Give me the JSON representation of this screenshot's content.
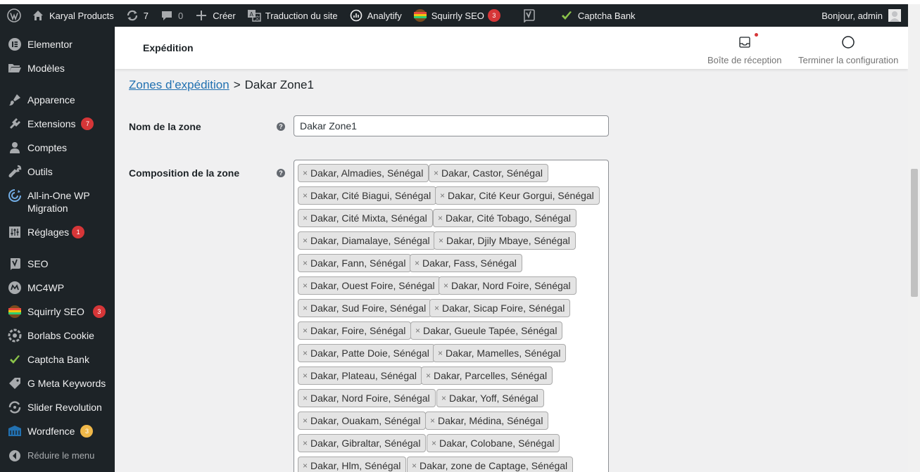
{
  "admin_bar": {
    "site_name": "Karyal Products",
    "updates_count": "7",
    "comments_count": "0",
    "new_label": "Créer",
    "translate_label": "Traduction du site",
    "analytify_label": "Analytify",
    "squirrly_label": "Squirrly SEO",
    "squirrly_badge": "3",
    "captcha_label": "Captcha Bank",
    "greeting": "Bonjour, admin"
  },
  "sidebar": {
    "items": [
      {
        "label": "Elementor",
        "icon": "elementor-icon"
      },
      {
        "label": "Modèles",
        "icon": "folder-icon"
      },
      {
        "label": "Apparence",
        "icon": "brush-icon"
      },
      {
        "label": "Extensions",
        "icon": "plugin-icon",
        "badge": "7"
      },
      {
        "label": "Comptes",
        "icon": "user-icon"
      },
      {
        "label": "Outils",
        "icon": "wrench-icon"
      },
      {
        "label": "All-in-One WP Migration",
        "icon": "migration-icon"
      },
      {
        "label": "Réglages",
        "icon": "settings-icon",
        "badge": "1"
      },
      {
        "label": "SEO",
        "icon": "yoast-icon"
      },
      {
        "label": "MC4WP",
        "icon": "mc4wp-icon"
      },
      {
        "label": "Squirrly SEO",
        "icon": "squirrly-icon",
        "badge": "3"
      },
      {
        "label": "Borlabs Cookie",
        "icon": "cookie-icon"
      },
      {
        "label": "Captcha Bank",
        "icon": "captcha-icon"
      },
      {
        "label": "G Meta Keywords",
        "icon": "tag-icon"
      },
      {
        "label": "Slider Revolution",
        "icon": "revolution-icon"
      },
      {
        "label": "Wordfence",
        "icon": "wordfence-icon",
        "badge": "3"
      }
    ],
    "collapse_label": "Réduire le menu"
  },
  "header": {
    "title": "Expédition",
    "inbox_label": "Boîte de réception",
    "setup_label": "Terminer la configuration"
  },
  "breadcrumb": {
    "link_label": "Zones d’expédition",
    "separator": ">",
    "current": "Dakar Zone1"
  },
  "form": {
    "zone_name_label": "Nom de la zone",
    "zone_name_value": "Dakar Zone1",
    "zone_regions_label": "Composition de la zone",
    "help_glyph": "?",
    "remove_glyph": "×",
    "regions": [
      "Dakar, Almadies, Sénégal",
      "Dakar, Castor, Sénégal",
      "Dakar, Cité Biagui, Sénégal",
      "Dakar, Cité Keur Gorgui, Sénégal",
      "Dakar, Cité Mixta, Sénégal",
      "Dakar, Cité Tobago, Sénégal",
      "Dakar, Diamalaye, Sénégal",
      "Dakar, Djily Mbaye, Sénégal",
      "Dakar, Fann, Sénégal",
      "Dakar, Fass, Sénégal",
      "Dakar, Ouest Foire, Sénégal",
      "Dakar, Nord Foire, Sénégal",
      "Dakar, Sud Foire, Sénégal",
      "Dakar, Sicap Foire, Sénégal",
      "Dakar, Foire, Sénégal",
      "Dakar, Gueule Tapée, Sénégal",
      "Dakar, Patte Doie, Sénégal",
      "Dakar, Mamelles, Sénégal",
      "Dakar, Plateau, Sénégal",
      "Dakar, Parcelles, Sénégal",
      "Dakar, Nord Foire, Sénégal",
      "Dakar, Yoff, Sénégal",
      "Dakar, Ouakam, Sénégal",
      "Dakar, Médina, Sénégal",
      "Dakar, Gibraltar, Sénégal",
      "Dakar, Colobane, Sénégal",
      "Dakar, Hlm, Sénégal",
      "Dakar, zone de Captage, Sénégal"
    ]
  },
  "colors": {
    "admin_bar_bg": "#1d2327",
    "link": "#2271b1",
    "badge_red": "#d63638",
    "badge_orange": "#f0b849"
  }
}
